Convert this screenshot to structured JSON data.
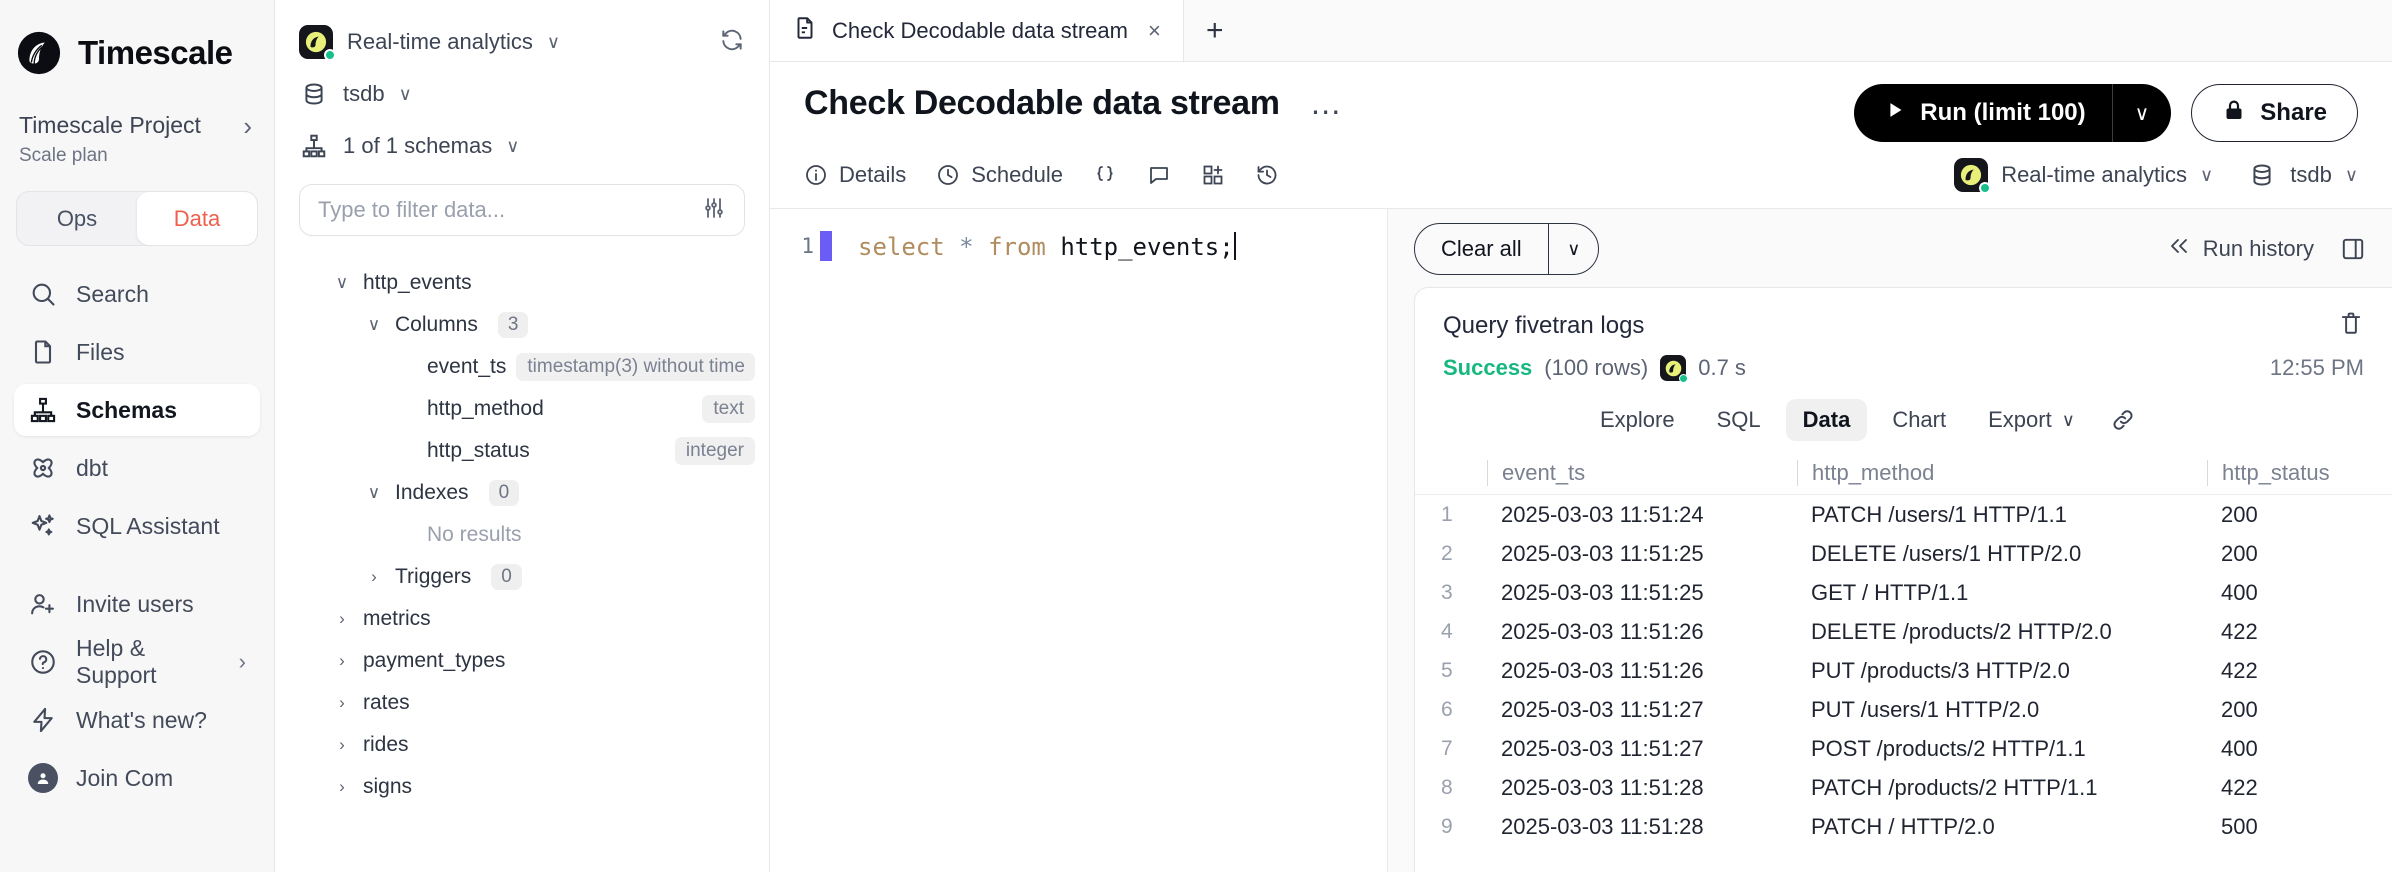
{
  "brand": {
    "name": "Timescale"
  },
  "project": {
    "name": "Timescale Project",
    "plan": "Scale plan",
    "chevron": "›"
  },
  "segment": {
    "ops": "Ops",
    "data": "Data"
  },
  "sidebar": {
    "items": [
      {
        "label": "Search",
        "icon": "search-icon"
      },
      {
        "label": "Files",
        "icon": "file-icon"
      },
      {
        "label": "Schemas",
        "icon": "schema-icon"
      },
      {
        "label": "dbt",
        "icon": "dbt-icon"
      },
      {
        "label": "SQL Assistant",
        "icon": "sparkles-icon"
      },
      {
        "label": "Invite users",
        "icon": "user-plus-icon"
      },
      {
        "label": "Help & Support",
        "icon": "help-circle-icon",
        "chevron": "›"
      },
      {
        "label": "What's new?",
        "icon": "lightning-icon"
      },
      {
        "label": "Join Com",
        "icon": "community-icon"
      }
    ]
  },
  "schema_panel": {
    "connection": "Real-time analytics",
    "connection_caret": "∨",
    "database": "tsdb",
    "database_caret": "∨",
    "schemas": "1 of 1 schemas",
    "schemas_caret": "∨",
    "filter_placeholder": "Type to filter data...",
    "filter_value": "",
    "tree": [
      {
        "name": "http_events",
        "indent": 1,
        "caret": "∨",
        "kind": "table"
      },
      {
        "name": "Columns",
        "indent": 2,
        "caret": "∨",
        "badge": "3",
        "kind": "group"
      },
      {
        "name": "event_ts",
        "indent": 3,
        "type": "timestamp(3) without time",
        "kind": "column"
      },
      {
        "name": "http_method",
        "indent": 3,
        "type": "text",
        "kind": "column"
      },
      {
        "name": "http_status",
        "indent": 3,
        "type": "integer",
        "kind": "column"
      },
      {
        "name": "Indexes",
        "indent": 2,
        "caret": "∨",
        "badge": "0",
        "kind": "group"
      },
      {
        "name": "No results",
        "indent": 3,
        "kind": "empty"
      },
      {
        "name": "Triggers",
        "indent": 2,
        "caret": "›",
        "badge": "0",
        "kind": "group"
      },
      {
        "name": "metrics",
        "indent": 1,
        "caret": "›",
        "kind": "table"
      },
      {
        "name": "payment_types",
        "indent": 1,
        "caret": "›",
        "kind": "table"
      },
      {
        "name": "rates",
        "indent": 1,
        "caret": "›",
        "kind": "table"
      },
      {
        "name": "rides",
        "indent": 1,
        "caret": "›",
        "kind": "table"
      },
      {
        "name": "signs",
        "indent": 1,
        "caret": "›",
        "kind": "table"
      }
    ]
  },
  "tabs": {
    "active_tab": "Check Decodable data stream",
    "close": "×",
    "add": "+"
  },
  "query": {
    "title": "Check Decodable data stream",
    "more": "…",
    "run_label": "Run (limit 100)",
    "run_caret": "∨",
    "share_label": "Share",
    "subtabs": [
      {
        "label": "Details",
        "icon": "info-icon"
      },
      {
        "label": "Schedule",
        "icon": "clock-icon"
      },
      {
        "label": "",
        "icon": "braces-icon"
      },
      {
        "label": "",
        "icon": "comment-icon"
      },
      {
        "label": "",
        "icon": "add-widget-icon"
      },
      {
        "label": "",
        "icon": "history-icon"
      }
    ],
    "context": {
      "connection": "Real-time analytics",
      "connection_caret": "∨",
      "database": "tsdb",
      "database_caret": "∨"
    }
  },
  "editor": {
    "line_number": "1",
    "tokens": [
      {
        "t": "select",
        "c": "kw"
      },
      {
        "t": " ",
        "c": "plain"
      },
      {
        "t": "*",
        "c": "op"
      },
      {
        "t": " ",
        "c": "plain"
      },
      {
        "t": "from",
        "c": "kw"
      },
      {
        "t": " ",
        "c": "plain"
      },
      {
        "t": "http_events;",
        "c": "id"
      }
    ],
    "text": "select * from http_events;"
  },
  "results": {
    "clear_all": "Clear all",
    "clear_caret": "∨",
    "run_history": "Run history",
    "card_title": "Query fivetran logs",
    "status": "Success",
    "rows_note": "(100 rows)",
    "duration": "0.7 s",
    "timestamp": "12:55 PM",
    "tabs": [
      {
        "label": "Explore",
        "active": false
      },
      {
        "label": "SQL",
        "active": false
      },
      {
        "label": "Data",
        "active": true
      },
      {
        "label": "Chart",
        "active": false
      },
      {
        "label": "Export",
        "active": false,
        "caret": "∨"
      }
    ],
    "columns": [
      "event_ts",
      "http_method",
      "http_status"
    ],
    "rows": [
      {
        "n": "1",
        "event_ts": "2025-03-03 11:51:24",
        "http_method": "PATCH /users/1 HTTP/1.1",
        "http_status": "200"
      },
      {
        "n": "2",
        "event_ts": "2025-03-03 11:51:25",
        "http_method": "DELETE /users/1 HTTP/2.0",
        "http_status": "200"
      },
      {
        "n": "3",
        "event_ts": "2025-03-03 11:51:25",
        "http_method": "GET / HTTP/1.1",
        "http_status": "400"
      },
      {
        "n": "4",
        "event_ts": "2025-03-03 11:51:26",
        "http_method": "DELETE /products/2 HTTP/2.0",
        "http_status": "422"
      },
      {
        "n": "5",
        "event_ts": "2025-03-03 11:51:26",
        "http_method": "PUT /products/3 HTTP/2.0",
        "http_status": "422"
      },
      {
        "n": "6",
        "event_ts": "2025-03-03 11:51:27",
        "http_method": "PUT /users/1 HTTP/2.0",
        "http_status": "200"
      },
      {
        "n": "7",
        "event_ts": "2025-03-03 11:51:27",
        "http_method": "POST /products/2 HTTP/1.1",
        "http_status": "400"
      },
      {
        "n": "8",
        "event_ts": "2025-03-03 11:51:28",
        "http_method": "PATCH /products/2 HTTP/1.1",
        "http_status": "422"
      },
      {
        "n": "9",
        "event_ts": "2025-03-03 11:51:28",
        "http_method": "PATCH / HTTP/2.0",
        "http_status": "500"
      }
    ]
  },
  "colors": {
    "accent": "#ef5f4c",
    "success": "#17b87f",
    "cursor": "#6b5cf6",
    "logo_yellow": "#e8f07a"
  }
}
